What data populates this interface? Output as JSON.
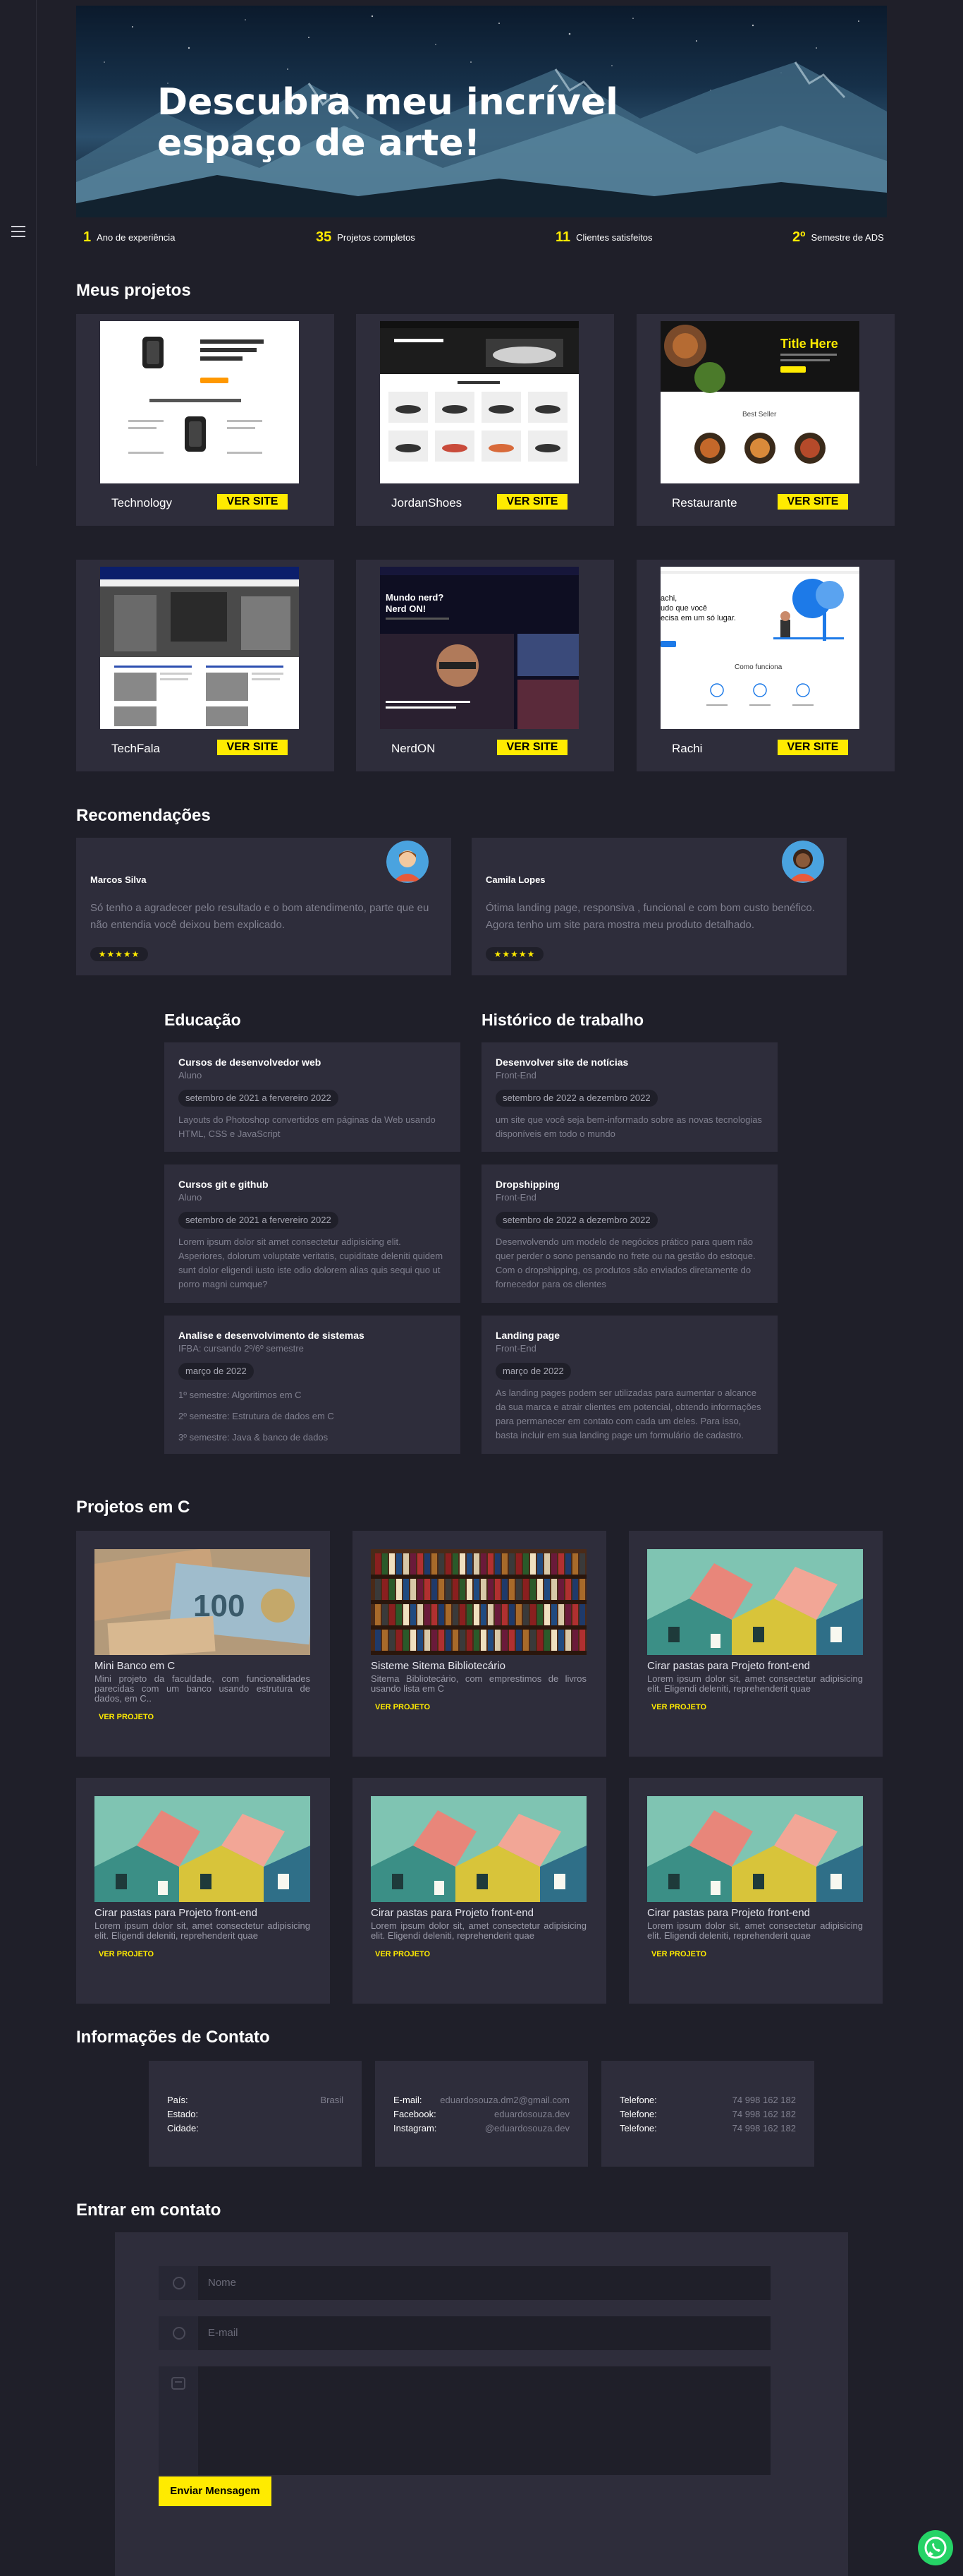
{
  "hero": {
    "title_line1": "Descubra meu incrível",
    "title_line2": "espaço de arte!"
  },
  "stats": [
    {
      "num": "1",
      "label": "Ano de experiência"
    },
    {
      "num": "35",
      "label": "Projetos completos"
    },
    {
      "num": "11",
      "label": "Clientes satisfeitos"
    },
    {
      "num": "2º",
      "label": "Semestre de ADS"
    }
  ],
  "projects": {
    "title": "Meus projetos",
    "button": "VER SITE",
    "items": [
      {
        "name": "Technology",
        "thumb_title": "Acredite na tecnologia, faça a mudança",
        "thumb_sub": "Nossos Recursos Principais"
      },
      {
        "name": "JordanShoes",
        "thumb_title": "A nova era do basquete",
        "thumb_sub": "Destaques"
      },
      {
        "name": "Restaurante",
        "thumb_title": "Title Here",
        "thumb_sub": "Best Seller"
      },
      {
        "name": "TechFala",
        "thumb_title": "",
        "thumb_sub": ""
      },
      {
        "name": "NerdON",
        "thumb_title": "Mundo nerd? Nerd ON!",
        "thumb_sub": ""
      },
      {
        "name": "Rachi",
        "thumb_title": "Rachi, tudo que você precisa em um só lugar.",
        "thumb_sub": "Como funciona"
      }
    ]
  },
  "recommendations": {
    "title": "Recomendações",
    "items": [
      {
        "name": "Marcos Silva",
        "text": "Só tenho a agradecer pelo resultado e o bom atendimento, parte que eu não entendia você deixou bem explicado.",
        "stars": "★★★★★"
      },
      {
        "name": "Camila Lopes",
        "text": "Ótima landing page, responsiva , funcional e com bom custo benéfico. Agora tenho um site para mostra meu produto detalhado.",
        "stars": "★★★★★"
      }
    ]
  },
  "education": {
    "title": "Educação",
    "items": [
      {
        "title": "Cursos de desenvolvedor web",
        "sub": "Aluno",
        "date": "setembro de 2021 a fervereiro 2022",
        "text": "Layouts do Photoshop convertidos em páginas da Web usando HTML, CSS e JavaScript"
      },
      {
        "title": "Cursos git e github",
        "sub": "Aluno",
        "date": "setembro de 2021 a fervereiro 2022",
        "text": "Lorem ipsum dolor sit amet consectetur adipisicing elit. Asperiores, dolorum voluptate veritatis, cupiditate deleniti quidem sunt dolor eligendi iusto iste odio dolorem alias quis sequi quo ut porro magni cumque?"
      },
      {
        "title": "Analise e desenvolvimento de sistemas",
        "sub": "IFBA: cursando 2º/6º semestre",
        "date": "março de 2022",
        "lines": [
          "1º semestre: Algoritimos em C",
          "2º semestre: Estrutura de dados em C",
          "3º semestre: Java & banco de dados"
        ]
      }
    ]
  },
  "work": {
    "title": "Histórico de trabalho",
    "items": [
      {
        "title": "Desenvolver site de notícias",
        "sub": "Front-End",
        "date": "setembro de 2022 a dezembro 2022",
        "text": "um site que você seja bem-informado sobre as novas tecnologias disponíveis em todo o mundo"
      },
      {
        "title": "Dropshipping",
        "sub": "Front-End",
        "date": "setembro de 2022 a dezembro 2022",
        "text": "Desenvolvendo um modelo de negócios prático para quem não quer perder o sono pensando no frete ou na gestão do estoque. Com o dropshipping, os produtos são enviados diretamente do fornecedor para os clientes"
      },
      {
        "title": "Landing page",
        "sub": "Front-End",
        "date": "março de 2022",
        "text": "As landing pages podem ser utilizadas para aumentar o alcance da sua marca e atrair clientes em potencial, obtendo informações para permanecer em contato com cada um deles. Para isso, basta incluir em sua landing page um formulário de cadastro."
      }
    ]
  },
  "c_projects": {
    "title": "Projetos em C",
    "link": "VER PROJETO",
    "items": [
      {
        "title": "Mini Banco em C",
        "text": "Mini projeto da faculdade, com funcionalidades parecidas com um banco usando estrutura de dados, em C..",
        "image": "money"
      },
      {
        "title": "Sisteme Sitema Bibliotecário",
        "text": "Sitema Bibliotecário, com emprestimos de livros usando lista em C",
        "image": "books"
      },
      {
        "title": "Cirar pastas para Projeto front-end",
        "text": "Lorem ipsum dolor sit, amet consectetur adipisicing elit. Eligendi deleniti, reprehenderit quae",
        "image": "houses"
      },
      {
        "title": "Cirar pastas para Projeto front-end",
        "text": "Lorem ipsum dolor sit, amet consectetur adipisicing elit. Eligendi deleniti, reprehenderit quae",
        "image": "houses"
      },
      {
        "title": "Cirar pastas para Projeto front-end",
        "text": "Lorem ipsum dolor sit, amet consectetur adipisicing elit. Eligendi deleniti, reprehenderit quae",
        "image": "houses"
      },
      {
        "title": "Cirar pastas para Projeto front-end",
        "text": "Lorem ipsum dolor sit, amet consectetur adipisicing elit. Eligendi deleniti, reprehenderit quae",
        "image": "houses"
      }
    ]
  },
  "contact_info": {
    "title": "Informações de Contato",
    "cards": [
      [
        {
          "k": "País:",
          "v": "Brasil"
        },
        {
          "k": "Estado:",
          "v": ""
        },
        {
          "k": "Cidade:",
          "v": ""
        }
      ],
      [
        {
          "k": "E-mail:",
          "v": "eduardosouza.dm2@gmail.com"
        },
        {
          "k": "Facebook:",
          "v": "eduardosouza.dev"
        },
        {
          "k": "Instagram:",
          "v": "@eduardosouza.dev"
        }
      ],
      [
        {
          "k": "Telefone:",
          "v": "74 998 162 182"
        },
        {
          "k": "Telefone:",
          "v": "74 998 162 182"
        },
        {
          "k": "Telefone:",
          "v": "74 998 162 182"
        }
      ]
    ]
  },
  "contact_form": {
    "title": "Entrar em contato",
    "name_placeholder": "Nome",
    "email_placeholder": "E-mail",
    "submit": "Enviar Mensagem"
  },
  "colors": {
    "accent": "#ffeb00",
    "bg": "#1f1f29",
    "card": "#2e2d3b",
    "whatsapp": "#25d366"
  },
  "icons": [
    "menu-icon",
    "user-icon",
    "email-icon",
    "message-icon",
    "whatsapp-icon"
  ]
}
